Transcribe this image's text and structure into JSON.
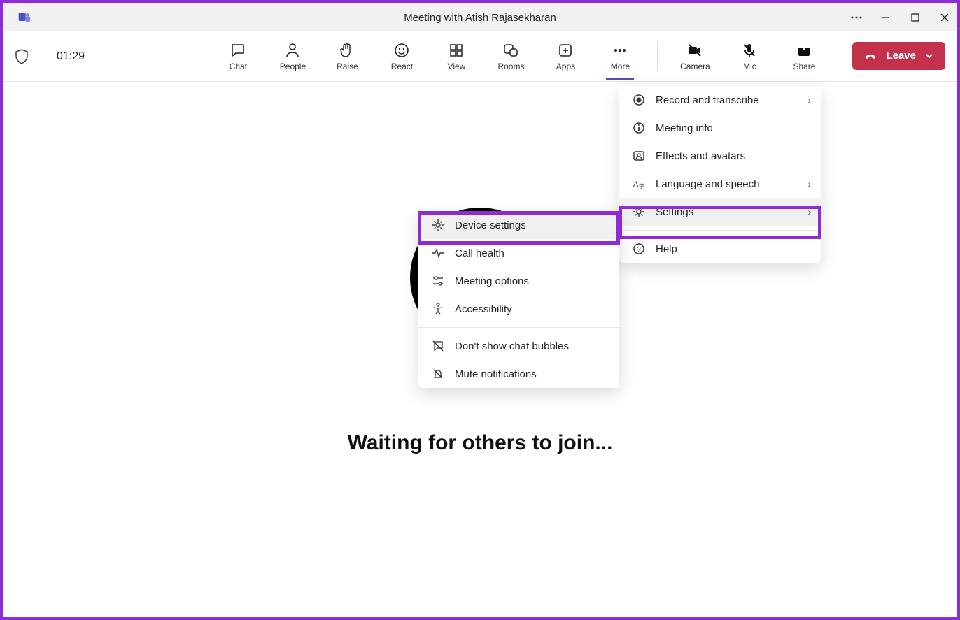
{
  "titlebar": {
    "title": "Meeting with Atish Rajasekharan"
  },
  "timer": "01:29",
  "tools": {
    "chat": "Chat",
    "people": "People",
    "raise": "Raise",
    "react": "React",
    "view": "View",
    "rooms": "Rooms",
    "apps": "Apps",
    "more": "More",
    "camera": "Camera",
    "mic": "Mic",
    "share": "Share"
  },
  "leave_label": "Leave",
  "waiting_text": "Waiting for others to join...",
  "more_menu": {
    "record": "Record and transcribe",
    "meeting_info": "Meeting info",
    "effects": "Effects and avatars",
    "language": "Language and speech",
    "settings": "Settings",
    "help": "Help"
  },
  "settings_submenu": {
    "device_settings": "Device settings",
    "call_health": "Call health",
    "meeting_options": "Meeting options",
    "accessibility": "Accessibility",
    "chat_bubbles": "Don't show chat bubbles",
    "mute_notifications": "Mute notifications"
  }
}
